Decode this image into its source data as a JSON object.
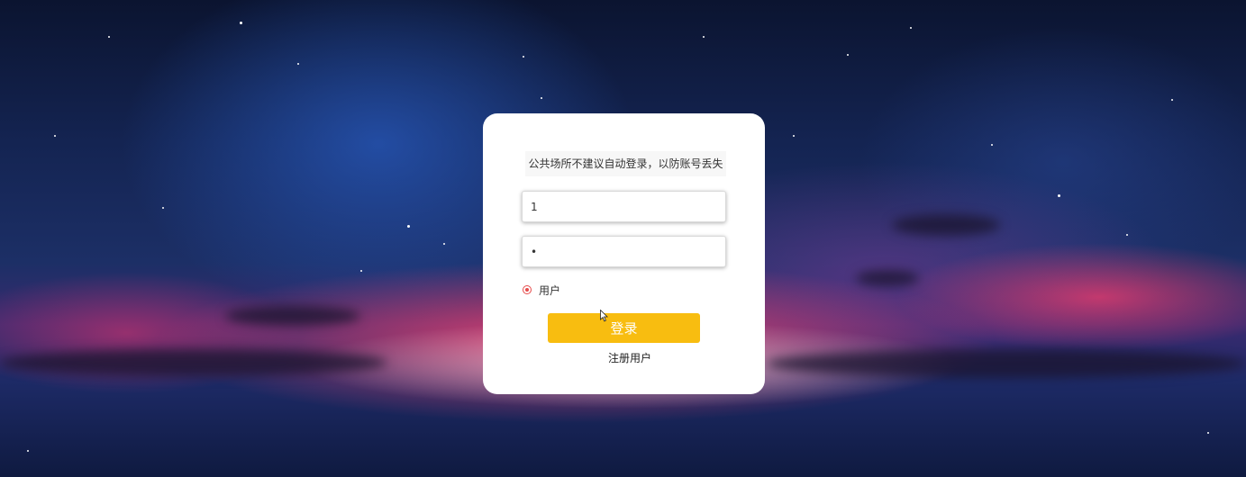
{
  "login": {
    "notice": "公共场所不建议自动登录，以防账号丢失",
    "username_value": "1",
    "password_value": "1",
    "role_label": "用户",
    "login_label": "登录",
    "register_label": "注册用户"
  },
  "colors": {
    "accent_button": "#f8bd10",
    "radio": "#e64b4b",
    "card": "#ffffff"
  },
  "icons": [
    "radio-selected-icon",
    "mouse-cursor-icon"
  ]
}
